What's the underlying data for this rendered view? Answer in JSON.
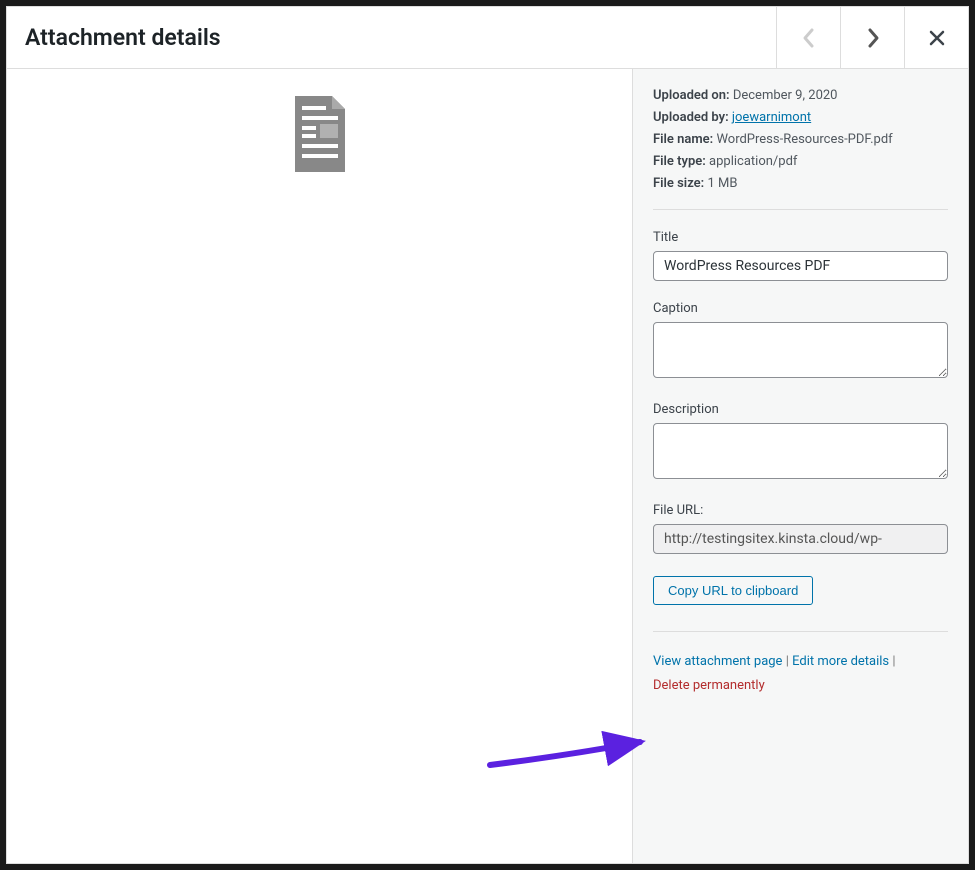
{
  "header": {
    "title": "Attachment details"
  },
  "meta": {
    "uploaded_on_label": "Uploaded on:",
    "uploaded_on": "December 9, 2020",
    "uploaded_by_label": "Uploaded by:",
    "uploaded_by": "joewarnimont",
    "file_name_label": "File name:",
    "file_name": "WordPress-Resources-PDF.pdf",
    "file_type_label": "File type:",
    "file_type": "application/pdf",
    "file_size_label": "File size:",
    "file_size": "1 MB"
  },
  "fields": {
    "title_label": "Title",
    "title_value": "WordPress Resources PDF",
    "caption_label": "Caption",
    "caption_value": "",
    "description_label": "Description",
    "description_value": "",
    "fileurl_label": "File URL:",
    "fileurl_value": "http://testingsitex.kinsta.cloud/wp-"
  },
  "buttons": {
    "copy_url": "Copy URL to clipboard"
  },
  "links": {
    "view_attachment": "View attachment page",
    "edit_more": "Edit more details",
    "delete": "Delete permanently"
  }
}
